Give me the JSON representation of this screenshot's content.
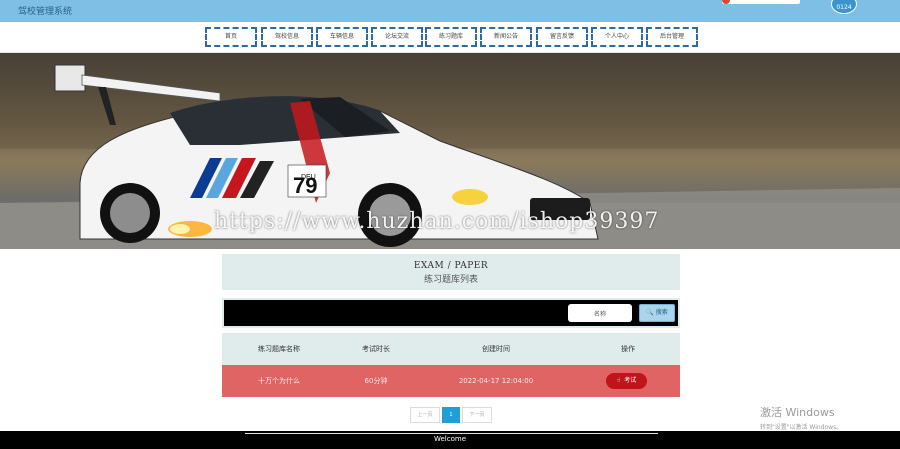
{
  "header": {
    "site_title": "驾校管理系统",
    "user_avatar_text": "0124"
  },
  "nav": {
    "items": [
      {
        "label": "首页"
      },
      {
        "label": "驾校信息"
      },
      {
        "label": "车辆信息"
      },
      {
        "label": "论坛交流"
      },
      {
        "label": "练习题库"
      },
      {
        "label": "新闻公告"
      },
      {
        "label": "留言反馈"
      },
      {
        "label": "个人中心"
      },
      {
        "label": "后台管理"
      }
    ]
  },
  "banner": {
    "watermark": "https://www.huzhan.com/ishop39397",
    "car_number": "79",
    "car_badge": "DEU"
  },
  "section": {
    "title_en": "EXAM / PAPER",
    "title_zh": "练习题库列表"
  },
  "search": {
    "input_value": "名称",
    "button_label": "搜索",
    "button_icon": "search-icon"
  },
  "table": {
    "columns": [
      "练习题库名称",
      "考试时长",
      "创建时间",
      "操作"
    ],
    "rows": [
      {
        "name": "十万个为什么",
        "duration": "60分钟",
        "created": "2022-04-17 12:04:00",
        "action": "考试"
      }
    ],
    "row_color": "#e06464",
    "action_color": "#c0131a"
  },
  "pagination": {
    "prev": "上一页",
    "current": "1",
    "next": "下一页"
  },
  "activation": {
    "title": "激活 Windows",
    "subtitle": "转到\"设置\"以激活 Windows。"
  },
  "footer": {
    "text": "Welcome"
  },
  "colors": {
    "topbar": "#7fbfe6",
    "nav_border": "#2c6aa0",
    "section_bg": "#e0ecec",
    "page_active": "#1e9fd6"
  }
}
